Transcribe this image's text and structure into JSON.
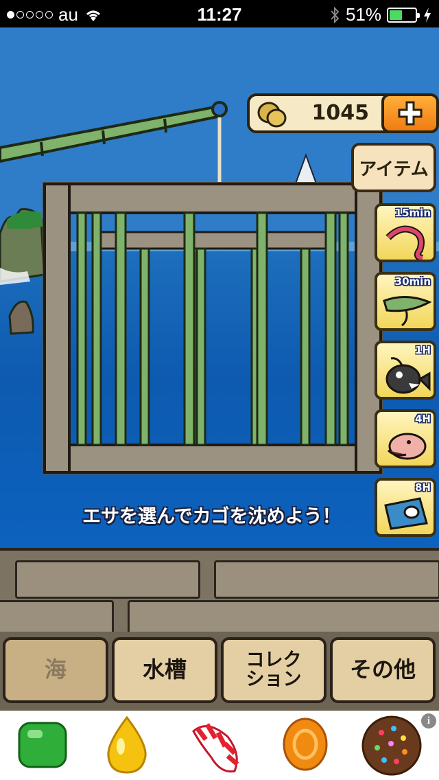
{
  "status_bar": {
    "carrier": "au",
    "time": "11:27",
    "battery_percent": "51%",
    "battery_level": 0.51,
    "signal_bars": 1
  },
  "coins": {
    "value": "1045"
  },
  "buttons": {
    "item": "アイテム"
  },
  "baits": [
    {
      "time": "15min",
      "icon": "red-worm-bait-icon"
    },
    {
      "time": "30min",
      "icon": "green-sardine-bait-icon"
    },
    {
      "time": "1H",
      "icon": "anglerfish-bait-icon"
    },
    {
      "time": "4H",
      "icon": "pink-fish-bait-icon"
    },
    {
      "time": "8H",
      "icon": "blue-fish-head-bait-icon"
    }
  ],
  "hint": "エサを選んでカゴを沈めよう！",
  "tabs": [
    {
      "label": "海",
      "active": true
    },
    {
      "label": "水槽",
      "active": false
    },
    {
      "label_line1": "コレク",
      "label_line2": "ション",
      "active": false
    },
    {
      "label": "その他",
      "active": false
    }
  ],
  "ad": {
    "info_glyph": "i",
    "items": [
      "green-candy-icon",
      "yellow-drop-candy-icon",
      "striped-candy-icon",
      "orange-candy-icon",
      "color-bomb-candy-icon"
    ]
  },
  "colors": {
    "accent_orange": "#f07d12",
    "sea_blue": "#0d5ab0",
    "bamboo_green": "#7fb26a"
  }
}
